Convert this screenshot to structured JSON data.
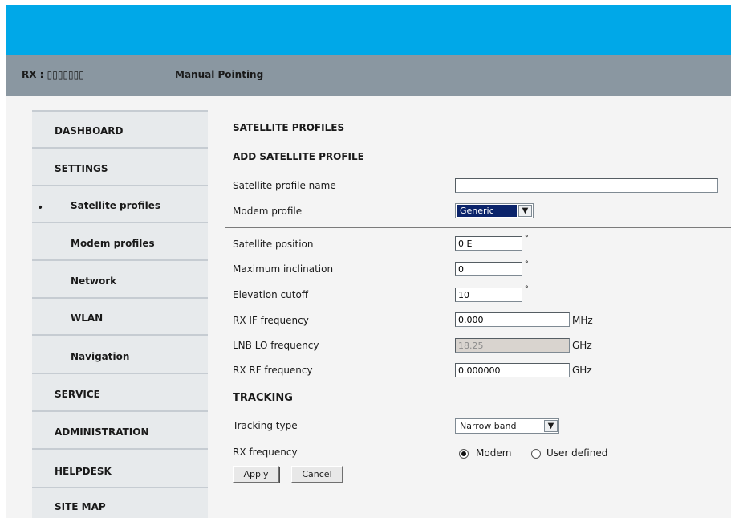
{
  "header": {
    "rx_label": "RX : ▯▯▯▯▯▯▯",
    "page_title": "Manual Pointing"
  },
  "colors": {
    "top_band": "#00a8e8",
    "title_bar": "#8a97a1",
    "sidebar": "#e7eaec"
  },
  "sidebar": {
    "items": [
      {
        "label": "DASHBOARD"
      },
      {
        "label": "SETTINGS"
      },
      {
        "label": "Satellite profiles",
        "active": true
      },
      {
        "label": "Modem profiles"
      },
      {
        "label": "Network"
      },
      {
        "label": "WLAN"
      },
      {
        "label": "Navigation"
      },
      {
        "label": "SERVICE"
      },
      {
        "label": "ADMINISTRATION"
      },
      {
        "label": "HELPDESK"
      },
      {
        "label": "SITE MAP"
      }
    ]
  },
  "main": {
    "section_title": "SATELLITE PROFILES",
    "add_title": "ADD SATELLITE PROFILE",
    "profile_name": {
      "label": "Satellite profile name",
      "value": ""
    },
    "modem_profile": {
      "label": "Modem profile",
      "value": "Generic"
    },
    "satellite_position": {
      "label": "Satellite position",
      "value": "0 E",
      "unit": "°"
    },
    "max_inclination": {
      "label": "Maximum inclination",
      "value": "0",
      "unit": "°"
    },
    "elevation_cutoff": {
      "label": "Elevation cutoff",
      "value": "10",
      "unit": "°"
    },
    "rx_if_freq": {
      "label": "RX IF frequency",
      "value": "0.000",
      "unit": "MHz"
    },
    "lnb_lo_freq": {
      "label": "LNB LO frequency",
      "value": "18.25",
      "unit": "GHz"
    },
    "rx_rf_freq": {
      "label": "RX RF frequency",
      "value": "0.000000",
      "unit": "GHz"
    },
    "tracking_title": "TRACKING",
    "tracking_type": {
      "label": "Tracking type",
      "value": "Narrow band"
    },
    "rx_frequency": {
      "label": "RX frequency",
      "option_modem": "Modem",
      "option_user": "User defined",
      "selected": "Modem"
    },
    "apply_label": "Apply",
    "cancel_label": "Cancel"
  }
}
